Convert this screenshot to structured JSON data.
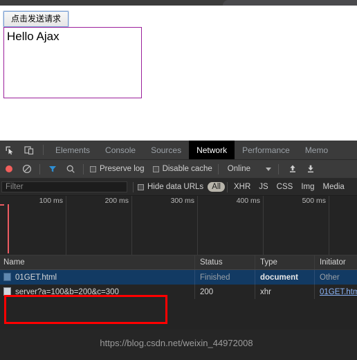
{
  "page": {
    "send_button_label": "点击发送请求",
    "result_text": "Hello Ajax",
    "result_box_border_color": "#9b1f9b"
  },
  "devtools": {
    "toolbar_icons": [
      {
        "name": "inspect-element-icon",
        "glyph": "inspect"
      },
      {
        "name": "device-toolbar-icon",
        "glyph": "device"
      }
    ],
    "tabs": [
      {
        "label": "Elements",
        "active": false
      },
      {
        "label": "Console",
        "active": false
      },
      {
        "label": "Sources",
        "active": false
      },
      {
        "label": "Network",
        "active": true
      },
      {
        "label": "Performance",
        "active": false
      },
      {
        "label": "Memo",
        "active": false
      }
    ],
    "controls": {
      "record_icon": "record-icon",
      "clear_icon": "clear-icon",
      "filter_icon": "filter-funnel-icon",
      "search_icon": "search-icon",
      "preserve_log_label": "Preserve log",
      "preserve_log_checked": false,
      "disable_cache_label": "Disable cache",
      "disable_cache_checked": false,
      "throttle_value": "Online",
      "import_icon": "import-har-icon",
      "export_icon": "export-har-icon"
    },
    "filterbar": {
      "filter_placeholder": "Filter",
      "filter_value": "",
      "hide_data_urls_label": "Hide data URLs",
      "hide_data_urls_checked": false,
      "type_chips": [
        {
          "label": "All",
          "selected": true
        },
        {
          "label": "XHR",
          "selected": false
        },
        {
          "label": "JS",
          "selected": false
        },
        {
          "label": "CSS",
          "selected": false
        },
        {
          "label": "Img",
          "selected": false
        },
        {
          "label": "Media",
          "selected": false
        }
      ]
    },
    "overview": {
      "tick_labels": [
        "100 ms",
        "200 ms",
        "300 ms",
        "400 ms",
        "500 ms"
      ],
      "marker_color": "#ec5b62"
    },
    "table": {
      "columns": [
        "Name",
        "Status",
        "Type",
        "Initiator"
      ],
      "rows": [
        {
          "name": "01GET.html",
          "status": "Finished",
          "type": "document",
          "initiator": "Other",
          "selected": true
        },
        {
          "name": "server?a=100&b=200&c=300",
          "status": "200",
          "type": "xhr",
          "initiator": "01GET.htm",
          "selected": false
        }
      ]
    }
  },
  "annotation": {
    "highlight_color": "#ff0000"
  },
  "watermark": {
    "text": "https://blog.csdn.net/weixin_44972008"
  }
}
